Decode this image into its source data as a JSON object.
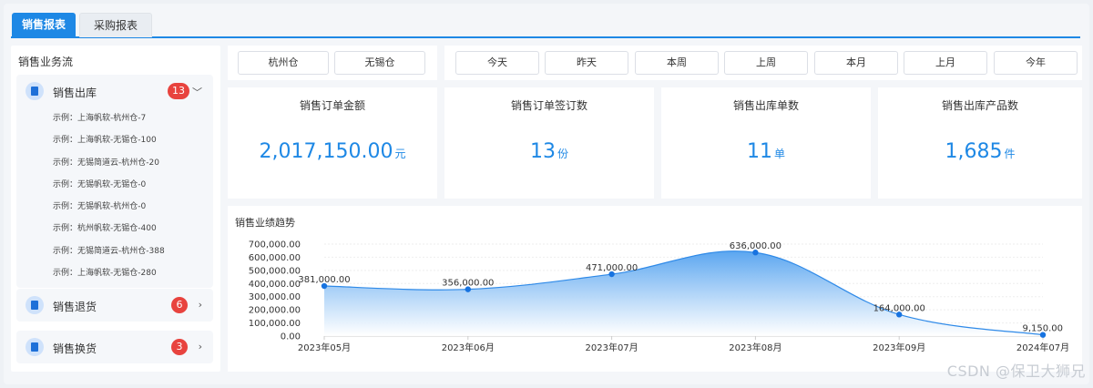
{
  "tabs": [
    {
      "label": "销售报表",
      "active": true
    },
    {
      "label": "采购报表",
      "active": false
    }
  ],
  "sidebar": {
    "title": "销售业务流",
    "groups": [
      {
        "label": "销售出库",
        "badge": "13",
        "icon": "document-icon",
        "expanded": true,
        "items": [
          "示例：上海帆软-杭州仓-7",
          "示例：上海帆软-无锡仓-100",
          "示例：无锡简道云-杭州仓-20",
          "示例：无锡帆软-无锡仓-0",
          "示例：无锡帆软-杭州仓-0",
          "示例：杭州帆软-无锡仓-400",
          "示例：无锡简道云-杭州仓-388",
          "示例：上海帆软-无锡仓-280"
        ]
      },
      {
        "label": "销售退货",
        "badge": "6",
        "icon": "document-icon",
        "expanded": false
      },
      {
        "label": "销售换货",
        "badge": "3",
        "icon": "document-icon",
        "expanded": false
      }
    ]
  },
  "warehouses": [
    "杭州仓",
    "无锡仓"
  ],
  "date_filters": [
    "今天",
    "昨天",
    "本周",
    "上周",
    "本月",
    "上月",
    "今年"
  ],
  "stats": [
    {
      "title": "销售订单金额",
      "value": "2,017,150.00",
      "unit": "元"
    },
    {
      "title": "销售订单签订数",
      "value": "13",
      "unit": "份"
    },
    {
      "title": "销售出库单数",
      "value": "11",
      "unit": "单"
    },
    {
      "title": "销售出库产品数",
      "value": "1,685",
      "unit": "件"
    }
  ],
  "chart_data": {
    "type": "area",
    "title": "销售业绩趋势",
    "categories": [
      "2023年05月",
      "2023年06月",
      "2023年07月",
      "2023年08月",
      "2023年09月",
      "2024年07月"
    ],
    "values": [
      381000,
      356000,
      471000,
      636000,
      164000,
      9150
    ],
    "value_labels": [
      "381,000.00",
      "356,000.00",
      "471,000.00",
      "636,000.00",
      "164,000.00",
      "9,150.00"
    ],
    "y_ticks": [
      "0.00",
      "100,000.00",
      "200,000.00",
      "300,000.00",
      "400,000.00",
      "500,000.00",
      "600,000.00",
      "700,000.00"
    ],
    "ylim": [
      0,
      700000
    ],
    "grid": true,
    "colors": {
      "line": "#2f8ae8",
      "point": "#1873e0",
      "area_top": "#5ba6f0",
      "area_bottom": "#ffffff"
    }
  },
  "watermark": "CSDN @保卫大狮兄"
}
